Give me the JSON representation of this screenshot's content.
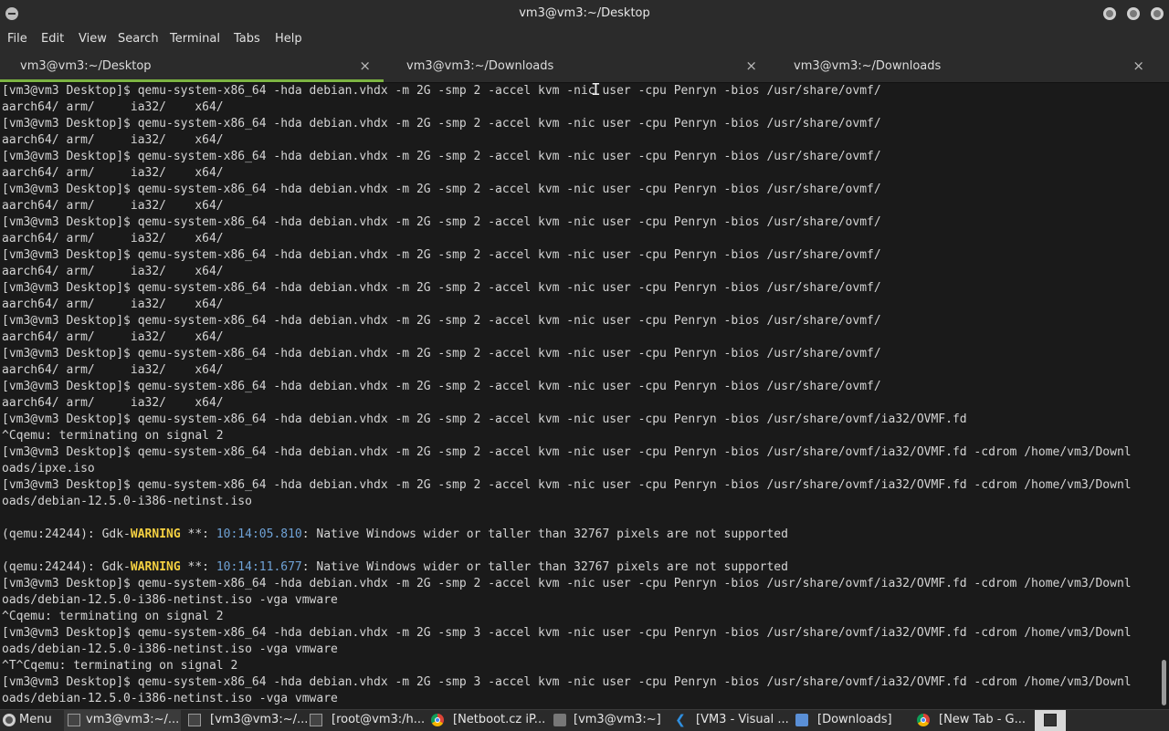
{
  "window": {
    "title": "vm3@vm3:~/Desktop"
  },
  "menubar": [
    "File",
    "Edit",
    "View",
    "Search",
    "Terminal",
    "Tabs",
    "Help"
  ],
  "tabs": [
    {
      "label": "vm3@vm3:~/Desktop",
      "active": true,
      "close": "×"
    },
    {
      "label": "vm3@vm3:~/Downloads",
      "active": false,
      "close": "×"
    },
    {
      "label": "vm3@vm3:~/Downloads",
      "active": false,
      "close": "×"
    }
  ],
  "terminal": {
    "lines": [
      "[vm3@vm3 Desktop]$ qemu-system-x86_64 -hda debian.vhdx -m 2G -smp 2 -accel kvm -nic user -cpu Penryn -bios /usr/share/ovmf/",
      "aarch64/ arm/     ia32/    x64/",
      "[vm3@vm3 Desktop]$ qemu-system-x86_64 -hda debian.vhdx -m 2G -smp 2 -accel kvm -nic user -cpu Penryn -bios /usr/share/ovmf/",
      "aarch64/ arm/     ia32/    x64/",
      "[vm3@vm3 Desktop]$ qemu-system-x86_64 -hda debian.vhdx -m 2G -smp 2 -accel kvm -nic user -cpu Penryn -bios /usr/share/ovmf/",
      "aarch64/ arm/     ia32/    x64/",
      "[vm3@vm3 Desktop]$ qemu-system-x86_64 -hda debian.vhdx -m 2G -smp 2 -accel kvm -nic user -cpu Penryn -bios /usr/share/ovmf/",
      "aarch64/ arm/     ia32/    x64/",
      "[vm3@vm3 Desktop]$ qemu-system-x86_64 -hda debian.vhdx -m 2G -smp 2 -accel kvm -nic user -cpu Penryn -bios /usr/share/ovmf/",
      "aarch64/ arm/     ia32/    x64/",
      "[vm3@vm3 Desktop]$ qemu-system-x86_64 -hda debian.vhdx -m 2G -smp 2 -accel kvm -nic user -cpu Penryn -bios /usr/share/ovmf/",
      "aarch64/ arm/     ia32/    x64/",
      "[vm3@vm3 Desktop]$ qemu-system-x86_64 -hda debian.vhdx -m 2G -smp 2 -accel kvm -nic user -cpu Penryn -bios /usr/share/ovmf/",
      "aarch64/ arm/     ia32/    x64/",
      "[vm3@vm3 Desktop]$ qemu-system-x86_64 -hda debian.vhdx -m 2G -smp 2 -accel kvm -nic user -cpu Penryn -bios /usr/share/ovmf/",
      "aarch64/ arm/     ia32/    x64/",
      "[vm3@vm3 Desktop]$ qemu-system-x86_64 -hda debian.vhdx -m 2G -smp 2 -accel kvm -nic user -cpu Penryn -bios /usr/share/ovmf/",
      "aarch64/ arm/     ia32/    x64/",
      "[vm3@vm3 Desktop]$ qemu-system-x86_64 -hda debian.vhdx -m 2G -smp 2 -accel kvm -nic user -cpu Penryn -bios /usr/share/ovmf/",
      "aarch64/ arm/     ia32/    x64/",
      "[vm3@vm3 Desktop]$ qemu-system-x86_64 -hda debian.vhdx -m 2G -smp 2 -accel kvm -nic user -cpu Penryn -bios /usr/share/ovmf/ia32/OVMF.fd",
      "^Cqemu: terminating on signal 2",
      "[vm3@vm3 Desktop]$ qemu-system-x86_64 -hda debian.vhdx -m 2G -smp 2 -accel kvm -nic user -cpu Penryn -bios /usr/share/ovmf/ia32/OVMF.fd -cdrom /home/vm3/Downl",
      "oads/ipxe.iso",
      "[vm3@vm3 Desktop]$ qemu-system-x86_64 -hda debian.vhdx -m 2G -smp 2 -accel kvm -nic user -cpu Penryn -bios /usr/share/ovmf/ia32/OVMF.fd -cdrom /home/vm3/Downl",
      "oads/debian-12.5.0-i386-netinst.iso",
      "",
      "",
      "",
      "",
      "[vm3@vm3 Desktop]$ qemu-system-x86_64 -hda debian.vhdx -m 2G -smp 2 -accel kvm -nic user -cpu Penryn -bios /usr/share/ovmf/ia32/OVMF.fd -cdrom /home/vm3/Downl",
      "oads/debian-12.5.0-i386-netinst.iso -vga vmware",
      "^Cqemu: terminating on signal 2",
      "[vm3@vm3 Desktop]$ qemu-system-x86_64 -hda debian.vhdx -m 2G -smp 3 -accel kvm -nic user -cpu Penryn -bios /usr/share/ovmf/ia32/OVMF.fd -cdrom /home/vm3/Downl",
      "oads/debian-12.5.0-i386-netinst.iso -vga vmware",
      "^T^Cqemu: terminating on signal 2",
      "[vm3@vm3 Desktop]$ qemu-system-x86_64 -hda debian.vhdx -m 2G -smp 3 -accel kvm -nic user -cpu Penryn -bios /usr/share/ovmf/ia32/OVMF.fd -cdrom /home/vm3/Downl",
      "oads/debian-12.5.0-i386-netinst.iso -vga vmware"
    ],
    "warnings": [
      {
        "prefix": "(qemu:24244): Gdk-",
        "level": "WARNING",
        "stars": " **: ",
        "time": "10:14:05.810",
        "message": ": Native Windows wider or taller than 32767 pixels are not supported"
      },
      {
        "prefix": "(qemu:24244): Gdk-",
        "level": "WARNING",
        "stars": " **: ",
        "time": "10:14:11.677",
        "message": ": Native Windows wider or taller than 32767 pixels are not supported"
      }
    ]
  },
  "taskbar": {
    "menu_label": "Menu",
    "items": [
      {
        "icon": "terminal-icon",
        "label": "vm3@vm3:~/...",
        "active": true
      },
      {
        "icon": "terminal-icon",
        "label": "[vm3@vm3:~/..."
      },
      {
        "icon": "terminal-icon",
        "label": "[root@vm3:/h..."
      },
      {
        "icon": "chrome-icon",
        "label": "[Netboot.cz iP..."
      },
      {
        "icon": "window-icon",
        "label": "[vm3@vm3:~]"
      },
      {
        "icon": "vscode-icon",
        "label": "[VM3 - Visual ..."
      },
      {
        "icon": "folder-icon",
        "label": "[Downloads]"
      },
      {
        "icon": "chrome-icon",
        "label": "[New Tab - G..."
      }
    ]
  }
}
